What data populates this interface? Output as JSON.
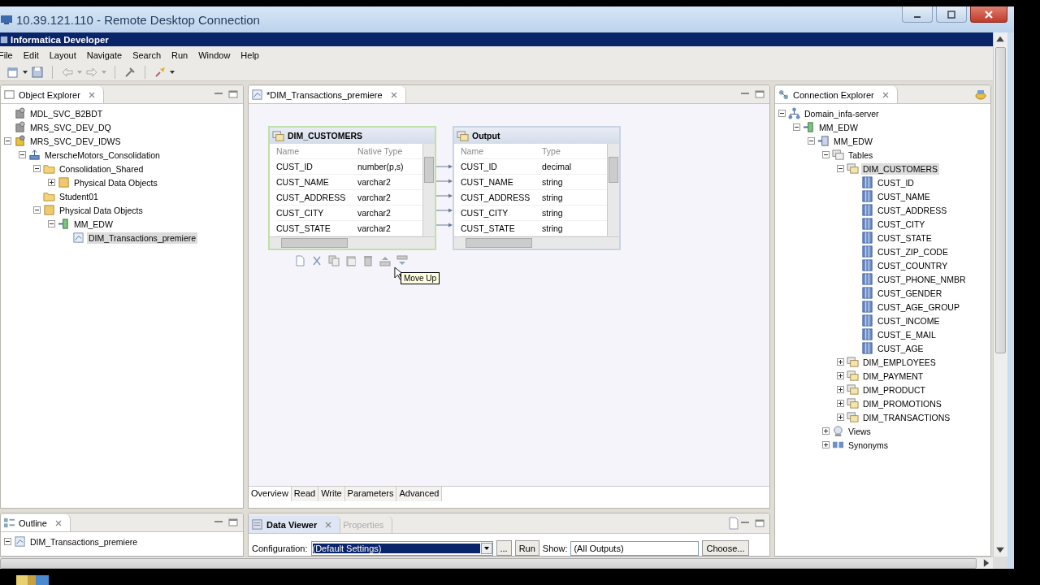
{
  "rdp_window": {
    "title": "10.39.121.110 - Remote Desktop Connection"
  },
  "app_title": "Informatica Developer",
  "menu": [
    "File",
    "Edit",
    "Layout",
    "Navigate",
    "Search",
    "Run",
    "Window",
    "Help"
  ],
  "object_explorer": {
    "title": "Object Explorer",
    "tree": [
      {
        "label": "MDL_SVC_B2BDT",
        "kind": "service",
        "selected": false
      },
      {
        "label": "MRS_SVC_DEV_DQ",
        "kind": "service",
        "selected": false
      },
      {
        "label": "MRS_SVC_DEV_IDWS",
        "kind": "service-active",
        "selected": false,
        "expanded": true,
        "children": [
          {
            "label": "MerscheMotors_Consolidation",
            "kind": "project",
            "selected": false,
            "expanded": true,
            "children": [
              {
                "label": "Consolidation_Shared",
                "kind": "folder",
                "selected": false,
                "expanded": true,
                "children": [
                  {
                    "label": "Physical Data Objects",
                    "kind": "category",
                    "selected": false,
                    "expanded": false
                  }
                ]
              },
              {
                "label": "Student01",
                "kind": "folder",
                "selected": false
              },
              {
                "label": "Physical Data Objects",
                "kind": "category",
                "selected": false,
                "expanded": true,
                "children": [
                  {
                    "label": "MM_EDW",
                    "kind": "connection",
                    "selected": false,
                    "expanded": true,
                    "children": [
                      {
                        "label": "DIM_Transactions_premiere",
                        "kind": "mapping",
                        "selected": true
                      }
                    ]
                  }
                ]
              }
            ]
          }
        ]
      }
    ]
  },
  "editor": {
    "tab": "*DIM_Transactions_premiere",
    "objects": [
      {
        "title": "DIM_CUSTOMERS",
        "selected": true,
        "columns": [
          "Name",
          "Native Type"
        ],
        "rows": [
          [
            "CUST_ID",
            "number(p,s)"
          ],
          [
            "CUST_NAME",
            "varchar2"
          ],
          [
            "CUST_ADDRESS",
            "varchar2"
          ],
          [
            "CUST_CITY",
            "varchar2"
          ],
          [
            "CUST_STATE",
            "varchar2"
          ]
        ]
      },
      {
        "title": "Output",
        "selected": false,
        "columns": [
          "Name",
          "Type"
        ],
        "rows": [
          [
            "CUST_ID",
            "decimal"
          ],
          [
            "CUST_NAME",
            "string"
          ],
          [
            "CUST_ADDRESS",
            "string"
          ],
          [
            "CUST_CITY",
            "string"
          ],
          [
            "CUST_STATE",
            "string"
          ]
        ]
      }
    ],
    "tooltip": "Move Up",
    "bottom_tabs": [
      {
        "label": "Overview",
        "selected": true
      },
      {
        "label": "Read",
        "selected": false
      },
      {
        "label": "Write",
        "selected": false
      },
      {
        "label": "Parameters",
        "selected": false
      },
      {
        "label": "Advanced",
        "selected": false
      }
    ]
  },
  "connection_explorer": {
    "title": "Connection Explorer",
    "tree": [
      {
        "label": "Domain_infa-server",
        "kind": "domain",
        "selected": false,
        "expanded": true,
        "children": [
          {
            "label": "MM_EDW",
            "kind": "connection",
            "selected": false,
            "expanded": true,
            "children": [
              {
                "label": "MM_EDW",
                "kind": "database",
                "selected": false,
                "expanded": true,
                "children": [
                  {
                    "label": "Tables",
                    "kind": "tables",
                    "selected": false,
                    "expanded": true,
                    "children": [
                      {
                        "label": "DIM_CUSTOMERS",
                        "kind": "table",
                        "selected": true,
                        "expanded": true,
                        "children": [
                          {
                            "label": "CUST_ID",
                            "kind": "column",
                            "selected": false
                          },
                          {
                            "label": "CUST_NAME",
                            "kind": "column",
                            "selected": false
                          },
                          {
                            "label": "CUST_ADDRESS",
                            "kind": "column",
                            "selected": false
                          },
                          {
                            "label": "CUST_CITY",
                            "kind": "column",
                            "selected": false
                          },
                          {
                            "label": "CUST_STATE",
                            "kind": "column",
                            "selected": false
                          },
                          {
                            "label": "CUST_ZIP_CODE",
                            "kind": "column",
                            "selected": false
                          },
                          {
                            "label": "CUST_COUNTRY",
                            "kind": "column",
                            "selected": false
                          },
                          {
                            "label": "CUST_PHONE_NMBR",
                            "kind": "column",
                            "selected": false
                          },
                          {
                            "label": "CUST_GENDER",
                            "kind": "column",
                            "selected": false
                          },
                          {
                            "label": "CUST_AGE_GROUP",
                            "kind": "column",
                            "selected": false
                          },
                          {
                            "label": "CUST_INCOME",
                            "kind": "column",
                            "selected": false
                          },
                          {
                            "label": "CUST_E_MAIL",
                            "kind": "column",
                            "selected": false
                          },
                          {
                            "label": "CUST_AGE",
                            "kind": "column",
                            "selected": false
                          }
                        ]
                      },
                      {
                        "label": "DIM_EMPLOYEES",
                        "kind": "table",
                        "selected": false,
                        "expanded": false
                      },
                      {
                        "label": "DIM_PAYMENT",
                        "kind": "table",
                        "selected": false,
                        "expanded": false
                      },
                      {
                        "label": "DIM_PRODUCT",
                        "kind": "table",
                        "selected": false,
                        "expanded": false
                      },
                      {
                        "label": "DIM_PROMOTIONS",
                        "kind": "table",
                        "selected": false,
                        "expanded": false
                      },
                      {
                        "label": "DIM_TRANSACTIONS",
                        "kind": "table",
                        "selected": false,
                        "expanded": false
                      }
                    ]
                  },
                  {
                    "label": "Views",
                    "kind": "views",
                    "selected": false,
                    "expanded": false
                  },
                  {
                    "label": "Synonyms",
                    "kind": "synonyms",
                    "selected": false,
                    "expanded": false
                  }
                ]
              }
            ]
          }
        ]
      }
    ]
  },
  "outline": {
    "title": "Outline",
    "tree": [
      {
        "label": "DIM_Transactions_premiere",
        "kind": "mapping",
        "selected": false,
        "expanded": true
      }
    ]
  },
  "data_viewer": {
    "tabs": [
      {
        "label": "Data Viewer",
        "selected": true
      },
      {
        "label": "Properties",
        "selected": false
      }
    ],
    "configuration_label": "Configuration:",
    "configuration_value": "(Default Settings)",
    "browse": "...",
    "run": "Run",
    "show_label": "Show:",
    "show_value": "(All Outputs)",
    "choose": "Choose..."
  }
}
